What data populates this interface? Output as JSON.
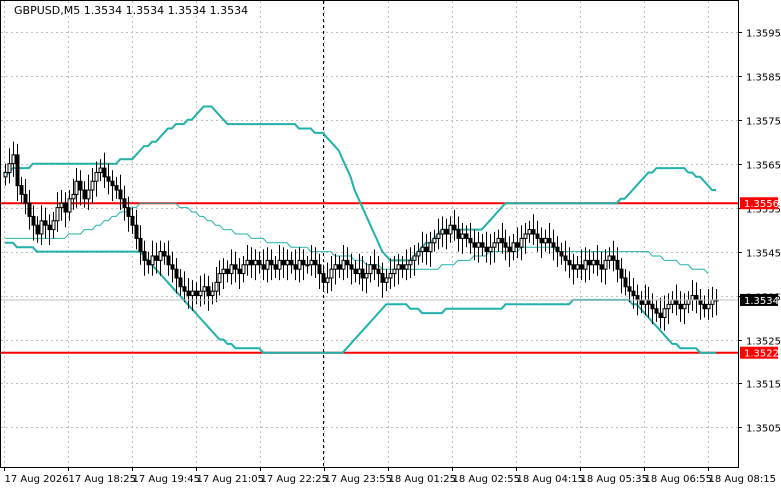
{
  "window": {
    "title": "GBPUSD,M5  1.3534 1.3534 1.3534 1.3534"
  },
  "colors": {
    "background": "#ffffff",
    "grid": "#c0c0c0",
    "candle": "#000000",
    "bollinger": "#20b2aa",
    "level_line": "#ff0000",
    "price_tag_bg": "#000000",
    "level_tag_bg": "#ff0000",
    "tag_text": "#ffffff"
  },
  "chart_data": {
    "type": "line",
    "title": "GBPUSD,M5  1.3534 1.3534 1.3534 1.3534",
    "xlabel": "",
    "ylabel": "",
    "ylim": [
      1.3496,
      1.3602
    ],
    "y_ticks": [
      1.3595,
      1.3585,
      1.3575,
      1.3565,
      1.3555,
      1.3545,
      1.3535,
      1.3525,
      1.3515,
      1.3505
    ],
    "y_tick_labels": [
      "1.3595",
      "1.3585",
      "1.3575",
      "1.3565",
      "1.3555",
      "1.3545",
      "1.3535",
      "1.3525",
      "1.3515",
      "1.3505"
    ],
    "x_tick_labels": [
      "17 Aug 2026",
      "17 Aug 18:25",
      "17 Aug 19:45",
      "17 Aug 21:05",
      "17 Aug 22:25",
      "17 Aug 23:55",
      "18 Aug 01:25",
      "18 Aug 02:55",
      "18 Aug 04:15",
      "18 Aug 05:35",
      "18 Aug 06:55",
      "18 Aug 08:15"
    ],
    "grid": true,
    "current_price": "1.3534",
    "horizontal_levels": [
      {
        "value": 1.3556,
        "label": "1.3556"
      },
      {
        "value": 1.3522,
        "label": "1.3522"
      }
    ],
    "cursor_index": 80,
    "close": [
      1.3563,
      1.3565,
      1.3567,
      1.356,
      1.3558,
      1.3556,
      1.3553,
      1.3551,
      1.3549,
      1.3552,
      1.3551,
      1.355,
      1.3552,
      1.3555,
      1.3556,
      1.3554,
      1.3557,
      1.3558,
      1.3561,
      1.3559,
      1.3557,
      1.3559,
      1.3561,
      1.3563,
      1.3564,
      1.3562,
      1.3561,
      1.356,
      1.3559,
      1.3557,
      1.3555,
      1.3553,
      1.3551,
      1.3548,
      1.3545,
      1.3543,
      1.3542,
      1.3544,
      1.3543,
      1.3545,
      1.3544,
      1.3542,
      1.3541,
      1.3539,
      1.3537,
      1.3536,
      1.3535,
      1.3536,
      1.3535,
      1.3536,
      1.3537,
      1.3535,
      1.3536,
      1.3538,
      1.354,
      1.3541,
      1.354,
      1.3542,
      1.3541,
      1.354,
      1.3542,
      1.3543,
      1.3542,
      1.3543,
      1.3542,
      1.3541,
      1.3543,
      1.3542,
      1.3541,
      1.3543,
      1.3542,
      1.3543,
      1.3542,
      1.3541,
      1.3543,
      1.3542,
      1.3542,
      1.3543,
      1.3542,
      1.354,
      1.3538,
      1.3539,
      1.3541,
      1.3542,
      1.3541,
      1.3543,
      1.3542,
      1.3541,
      1.354,
      1.3541,
      1.3539,
      1.354,
      1.3542,
      1.3541,
      1.354,
      1.3538,
      1.3539,
      1.354,
      1.3541,
      1.3542,
      1.3541,
      1.3542,
      1.3543,
      1.3544,
      1.3545,
      1.3546,
      1.3545,
      1.3547,
      1.3548,
      1.3549,
      1.355,
      1.3549,
      1.3551,
      1.355,
      1.3548,
      1.3549,
      1.3548,
      1.3547,
      1.3546,
      1.3547,
      1.3546,
      1.3545,
      1.3546,
      1.3547,
      1.3548,
      1.3547,
      1.3546,
      1.3545,
      1.3547,
      1.3546,
      1.3548,
      1.3549,
      1.355,
      1.3549,
      1.3548,
      1.3547,
      1.3548,
      1.3547,
      1.3546,
      1.3545,
      1.3544,
      1.3543,
      1.3542,
      1.3541,
      1.3542,
      1.3541,
      1.3543,
      1.3542,
      1.3543,
      1.3542,
      1.3541,
      1.3543,
      1.3544,
      1.3543,
      1.3541,
      1.3539,
      1.3537,
      1.3536,
      1.3535,
      1.3534,
      1.3533,
      1.3534,
      1.3533,
      1.3532,
      1.3531,
      1.353,
      1.3532,
      1.3533,
      1.3534,
      1.3533,
      1.3532,
      1.3533,
      1.3534,
      1.3535,
      1.3534,
      1.3533,
      1.3532,
      1.3533,
      1.3534,
      1.3534
    ],
    "series": [
      {
        "values": [
          1.3562,
          1.3563,
          1.3564,
          1.3564,
          1.3564,
          1.3564,
          1.3564,
          1.3565,
          1.3565,
          1.3565,
          1.3565,
          1.3565,
          1.3565,
          1.3565,
          1.3565,
          1.3565,
          1.3565,
          1.3565,
          1.3565,
          1.3565,
          1.3565,
          1.3565,
          1.3565,
          1.3565,
          1.3565,
          1.3565,
          1.3565,
          1.3565,
          1.3565,
          1.3566,
          1.3566,
          1.3566,
          1.3566,
          1.3567,
          1.3568,
          1.3569,
          1.3569,
          1.357,
          1.357,
          1.3571,
          1.3572,
          1.3573,
          1.3573,
          1.3574,
          1.3574,
          1.3574,
          1.3575,
          1.3575,
          1.3576,
          1.3577,
          1.3578,
          1.3578,
          1.3578,
          1.3577,
          1.3576,
          1.3575,
          1.3574,
          1.3574,
          1.3574,
          1.3574,
          1.3574,
          1.3574,
          1.3574,
          1.3574,
          1.3574,
          1.3574,
          1.3574,
          1.3574,
          1.3574,
          1.3574,
          1.3574,
          1.3574,
          1.3574,
          1.3574,
          1.3573,
          1.3573,
          1.3573,
          1.3573,
          1.3572,
          1.3572,
          1.3572,
          1.3571,
          1.357,
          1.3569,
          1.3568,
          1.3566,
          1.3564,
          1.3562,
          1.3559,
          1.3557,
          1.3555,
          1.3553,
          1.3551,
          1.3549,
          1.3547,
          1.3545,
          1.3544,
          1.3543,
          1.3543,
          1.3543,
          1.3543,
          1.3543,
          1.3543,
          1.3544,
          1.3545,
          1.3546,
          1.3547,
          1.3547,
          1.3548,
          1.3549,
          1.355,
          1.355,
          1.355,
          1.355,
          1.355,
          1.355,
          1.355,
          1.355,
          1.355,
          1.355,
          1.355,
          1.3551,
          1.3552,
          1.3553,
          1.3554,
          1.3555,
          1.3556,
          1.3556,
          1.3556,
          1.3556,
          1.3556,
          1.3556,
          1.3556,
          1.3556,
          1.3556,
          1.3556,
          1.3556,
          1.3556,
          1.3556,
          1.3556,
          1.3556,
          1.3556,
          1.3556,
          1.3556,
          1.3556,
          1.3556,
          1.3556,
          1.3556,
          1.3556,
          1.3556,
          1.3556,
          1.3556,
          1.3556,
          1.3556,
          1.3556,
          1.3557,
          1.3557,
          1.3558,
          1.3559,
          1.356,
          1.3561,
          1.3562,
          1.3563,
          1.3563,
          1.3564,
          1.3564,
          1.3564,
          1.3564,
          1.3564,
          1.3564,
          1.3564,
          1.3564,
          1.3563,
          1.3563,
          1.3562,
          1.3562,
          1.3561,
          1.356,
          1.3559,
          1.3559
        ]
      },
      {
        "values": [
          1.3547,
          1.3547,
          1.3547,
          1.3546,
          1.3546,
          1.3546,
          1.3546,
          1.3546,
          1.3545,
          1.3545,
          1.3545,
          1.3545,
          1.3545,
          1.3545,
          1.3545,
          1.3545,
          1.3545,
          1.3545,
          1.3545,
          1.3545,
          1.3545,
          1.3545,
          1.3545,
          1.3545,
          1.3545,
          1.3545,
          1.3545,
          1.3545,
          1.3545,
          1.3545,
          1.3545,
          1.3545,
          1.3545,
          1.3545,
          1.3545,
          1.3544,
          1.3543,
          1.3542,
          1.3541,
          1.354,
          1.3539,
          1.3538,
          1.3537,
          1.3536,
          1.3535,
          1.3534,
          1.3533,
          1.3532,
          1.3531,
          1.353,
          1.3529,
          1.3528,
          1.3527,
          1.3526,
          1.3525,
          1.3525,
          1.3524,
          1.3524,
          1.3523,
          1.3523,
          1.3523,
          1.3523,
          1.3523,
          1.3523,
          1.3523,
          1.3522,
          1.3522,
          1.3522,
          1.3522,
          1.3522,
          1.3522,
          1.3522,
          1.3522,
          1.3522,
          1.3522,
          1.3522,
          1.3522,
          1.3522,
          1.3522,
          1.3522,
          1.3522,
          1.3522,
          1.3522,
          1.3522,
          1.3522,
          1.3522,
          1.3523,
          1.3524,
          1.3525,
          1.3526,
          1.3527,
          1.3528,
          1.3529,
          1.353,
          1.3531,
          1.3532,
          1.3533,
          1.3533,
          1.3533,
          1.3533,
          1.3533,
          1.3533,
          1.3532,
          1.3532,
          1.3532,
          1.3531,
          1.3531,
          1.3531,
          1.3531,
          1.3531,
          1.3531,
          1.3532,
          1.3532,
          1.3532,
          1.3532,
          1.3532,
          1.3532,
          1.3532,
          1.3532,
          1.3532,
          1.3532,
          1.3532,
          1.3532,
          1.3532,
          1.3532,
          1.3532,
          1.3533,
          1.3533,
          1.3533,
          1.3533,
          1.3533,
          1.3533,
          1.3533,
          1.3533,
          1.3533,
          1.3533,
          1.3533,
          1.3533,
          1.3533,
          1.3533,
          1.3533,
          1.3533,
          1.3533,
          1.3534,
          1.3534,
          1.3534,
          1.3534,
          1.3534,
          1.3534,
          1.3534,
          1.3534,
          1.3534,
          1.3534,
          1.3534,
          1.3534,
          1.3534,
          1.3534,
          1.3534,
          1.3533,
          1.3533,
          1.3532,
          1.3531,
          1.353,
          1.3529,
          1.3528,
          1.3527,
          1.3526,
          1.3525,
          1.3524,
          1.3524,
          1.3523,
          1.3523,
          1.3523,
          1.3523,
          1.3523,
          1.3522,
          1.3522,
          1.3522,
          1.3522,
          1.3522
        ]
      },
      {
        "values": [
          1.3548,
          1.3548,
          1.3548,
          1.3548,
          1.3548,
          1.3548,
          1.3548,
          1.3548,
          1.3548,
          1.3548,
          1.3548,
          1.3548,
          1.3548,
          1.3548,
          1.3548,
          1.3548,
          1.3549,
          1.3549,
          1.3549,
          1.3549,
          1.355,
          1.355,
          1.355,
          1.3551,
          1.3551,
          1.3552,
          1.3552,
          1.3553,
          1.3553,
          1.3554,
          1.3554,
          1.3554,
          1.3555,
          1.3555,
          1.3556,
          1.3556,
          1.3556,
          1.3556,
          1.3556,
          1.3556,
          1.3556,
          1.3556,
          1.3556,
          1.3556,
          1.3555,
          1.3555,
          1.3555,
          1.3554,
          1.3554,
          1.3553,
          1.3553,
          1.3552,
          1.3552,
          1.3551,
          1.3551,
          1.355,
          1.355,
          1.355,
          1.3549,
          1.3549,
          1.3549,
          1.3549,
          1.3548,
          1.3548,
          1.3548,
          1.3548,
          1.3547,
          1.3547,
          1.3547,
          1.3547,
          1.3547,
          1.3547,
          1.3546,
          1.3546,
          1.3546,
          1.3546,
          1.3546,
          1.3545,
          1.3545,
          1.3545,
          1.3545,
          1.3545,
          1.3545,
          1.3544,
          1.3544,
          1.3544,
          1.3544,
          1.3544,
          1.3543,
          1.3543,
          1.3543,
          1.3542,
          1.3542,
          1.3542,
          1.3542,
          1.3541,
          1.3541,
          1.3541,
          1.3541,
          1.3541,
          1.3541,
          1.3541,
          1.3541,
          1.3541,
          1.3541,
          1.3541,
          1.3541,
          1.3541,
          1.3541,
          1.3541,
          1.3542,
          1.3542,
          1.3542,
          1.3542,
          1.3543,
          1.3543,
          1.3543,
          1.3543,
          1.3544,
          1.3544,
          1.3544,
          1.3544,
          1.3545,
          1.3545,
          1.3545,
          1.3545,
          1.3545,
          1.3545,
          1.3545,
          1.3545,
          1.3546,
          1.3546,
          1.3546,
          1.3546,
          1.3546,
          1.3546,
          1.3546,
          1.3546,
          1.3546,
          1.3545,
          1.3545,
          1.3545,
          1.3545,
          1.3545,
          1.3545,
          1.3545,
          1.3545,
          1.3545,
          1.3545,
          1.3545,
          1.3545,
          1.3545,
          1.3545,
          1.3545,
          1.3545,
          1.3545,
          1.3545,
          1.3545,
          1.3545,
          1.3545,
          1.3545,
          1.3545,
          1.3545,
          1.3544,
          1.3544,
          1.3544,
          1.3543,
          1.3543,
          1.3543,
          1.3543,
          1.3542,
          1.3542,
          1.3542,
          1.3541,
          1.3541,
          1.3541,
          1.3541,
          1.354
        ]
      }
    ]
  }
}
